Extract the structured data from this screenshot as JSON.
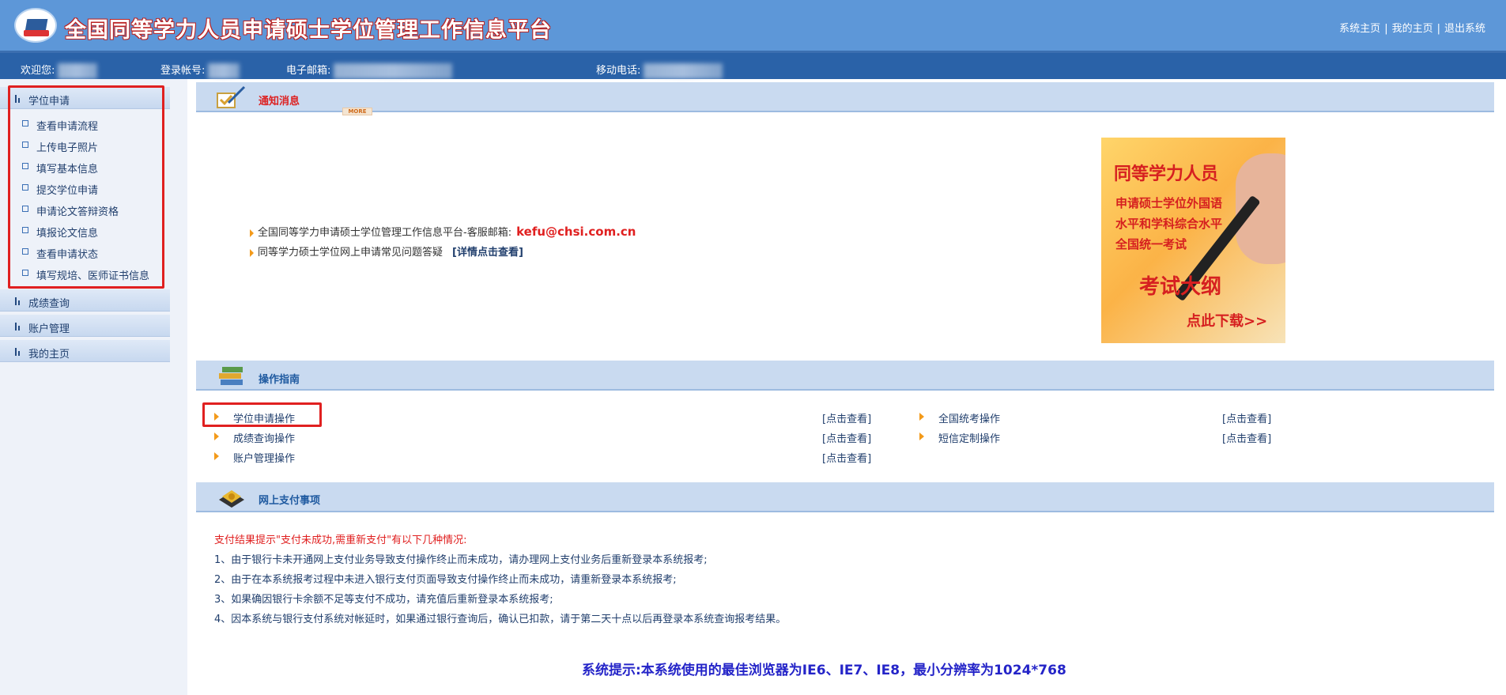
{
  "header": {
    "site_title": "全国同等学力人员申请硕士学位管理工作信息平台",
    "links": [
      "系统主页",
      "我的主页",
      "退出系统"
    ]
  },
  "userbar": {
    "welcome_label": "欢迎您:",
    "account_label": "登录帐号:",
    "email_label": "电子邮箱:",
    "mobile_label": "移动电话:"
  },
  "sidebar": {
    "sections": [
      {
        "label": "学位申请",
        "items": [
          "查看申请流程",
          "上传电子照片",
          "填写基本信息",
          "提交学位申请",
          "申请论文答辩资格",
          "填报论文信息",
          "查看申请状态",
          "填写规培、医师证书信息"
        ]
      },
      {
        "label": "成绩查询"
      },
      {
        "label": "账户管理"
      },
      {
        "label": "我的主页"
      }
    ]
  },
  "notice": {
    "title": "通知消息",
    "more": "MORE",
    "lines": [
      {
        "text": "全国同等学力申请硕士学位管理工作信息平台-客服邮箱:",
        "email": "kefu@chsi.com.cn"
      },
      {
        "text": "同等学力硕士学位网上申请常见问题答疑",
        "detail": "[详情点击查看]"
      }
    ],
    "banner": {
      "title": "同等学力人员",
      "lines": [
        "申请硕士学位外国语",
        "水平和学科综合水平",
        "全国统一考试"
      ],
      "headline": "考试大纲",
      "cta": "点此下载>>"
    }
  },
  "guide": {
    "title": "操作指南",
    "view_label": "[点击查看]",
    "left": [
      "学位申请操作",
      "成绩查询操作",
      "账户管理操作"
    ],
    "right": [
      "全国统考操作",
      "短信定制操作"
    ]
  },
  "payment": {
    "title": "网上支付事项",
    "intro": "支付结果提示\"支付未成功,需重新支付\"有以下几种情况:",
    "items": [
      "1、由于银行卡未开通网上支付业务导致支付操作终止而未成功，请办理网上支付业务后重新登录本系统报考;",
      "2、由于在本系统报考过程中未进入银行支付页面导致支付操作终止而未成功，请重新登录本系统报考;",
      "3、如果确因银行卡余额不足等支付不成功，请充值后重新登录本系统报考;",
      "4、因本系统与银行支付系统对帐延时，如果通过银行查询后，确认已扣款，请于第二天十点以后再登录本系统查询报考结果。"
    ]
  },
  "footer": {
    "tip": "系统提示:本系统使用的最佳浏览器为IE6、IE7、IE8，最小分辨率为1024*768"
  },
  "colors": {
    "header_bg": "#5d97d8",
    "userbar_bg": "#2a62a8",
    "highlight_box": "#e02020",
    "accent_orange": "#f39a1a",
    "tip_blue": "#2424c8"
  }
}
